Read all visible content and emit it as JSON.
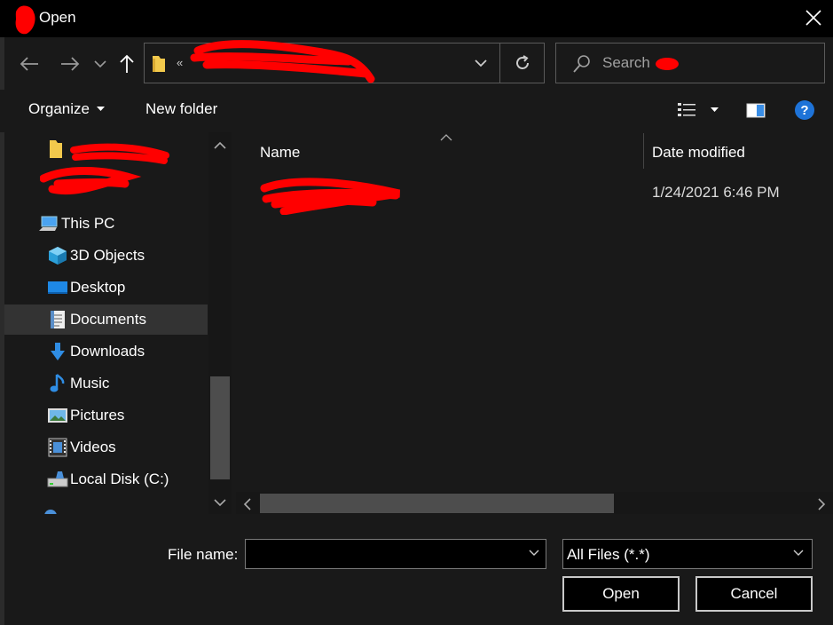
{
  "window": {
    "title": "Open"
  },
  "search": {
    "placeholder": "Search"
  },
  "toolbar": {
    "organize_label": "Organize",
    "new_folder_label": "New folder"
  },
  "nav_pane": {
    "items": [
      {
        "label": "This PC",
        "icon": "computer-icon"
      },
      {
        "label": "3D Objects",
        "icon": "cube-icon"
      },
      {
        "label": "Desktop",
        "icon": "desktop-icon"
      },
      {
        "label": "Documents",
        "icon": "document-icon",
        "selected": true
      },
      {
        "label": "Downloads",
        "icon": "download-arrow-icon"
      },
      {
        "label": "Music",
        "icon": "music-note-icon"
      },
      {
        "label": "Pictures",
        "icon": "picture-icon"
      },
      {
        "label": "Videos",
        "icon": "film-icon"
      },
      {
        "label": "Local Disk (C:)",
        "icon": "drive-icon"
      }
    ]
  },
  "file_list": {
    "columns": [
      "Name",
      "Date modified"
    ],
    "rows": [
      {
        "date_modified": "1/24/2021 6:46 PM"
      }
    ]
  },
  "footer": {
    "file_name_label": "File name:",
    "file_name_value": "",
    "file_type": "All Files (*.*)",
    "open_label": "Open",
    "cancel_label": "Cancel"
  },
  "colors": {
    "background": "#191919",
    "title_bar": "#000000",
    "accent_blue": "#1e90ff",
    "redaction": "#ff0000"
  }
}
